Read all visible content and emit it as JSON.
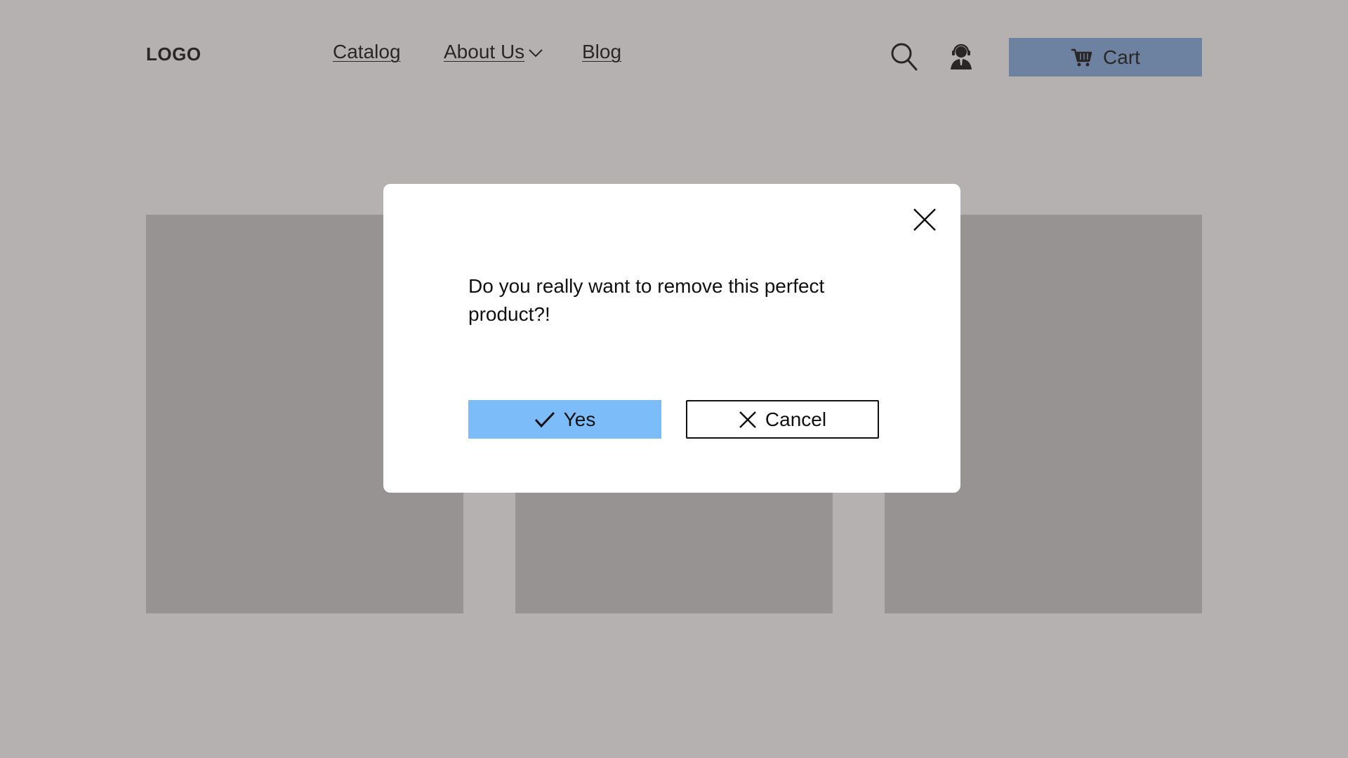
{
  "header": {
    "logo": "LOGO",
    "nav": [
      {
        "label": "Catalog"
      },
      {
        "label": "About Us"
      },
      {
        "label": "Blog"
      }
    ],
    "search_icon": "search-icon",
    "support_icon": "support-agent-icon",
    "cart": {
      "label": "Cart",
      "icon": "shopping-cart-icon"
    }
  },
  "dialog": {
    "message": "Do you really want to remove this perfect product?!",
    "confirm_label": "Yes",
    "confirm_icon": "check-icon",
    "cancel_label": "Cancel",
    "cancel_icon": "close-icon",
    "close_icon": "close-icon"
  },
  "colors": {
    "cart_button": "#8bb3e6",
    "confirm_button": "#7bbcf9",
    "card_placeholder": "#cfcfcf",
    "overlay": "rgba(60,50,50,0.38)"
  }
}
